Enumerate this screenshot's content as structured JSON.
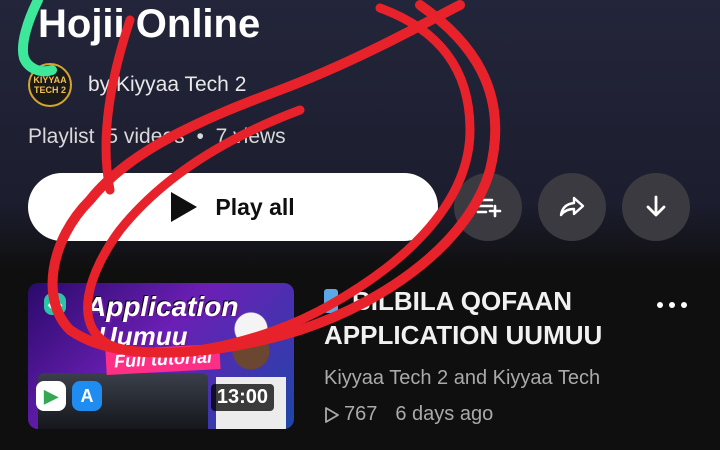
{
  "playlist": {
    "title": "Hojii Online",
    "byline": "by Kiyyaa Tech 2",
    "avatar_text": "KIYYAA TECH 2",
    "meta_type": "Playlist",
    "meta_videos": "5 videos",
    "meta_separator": "•",
    "meta_views": "7 views"
  },
  "actions": {
    "play_all_label": "Play all",
    "save_icon": "playlist-save-icon",
    "share_icon": "share-icon",
    "download_icon": "download-icon"
  },
  "video": {
    "thumbnail": {
      "title": "Application",
      "subtitle": "Uumuu",
      "tag": "Full tutorial"
    },
    "duration": "13:00",
    "title": "BILBILA QOFAAN APPLICATION UUMUU",
    "channel": "Kiyyaa Tech 2 and Kiyyaa Tech",
    "views": "767",
    "age": "6 days ago",
    "menu_icon": "more-vertical-icon"
  },
  "colors": {
    "annotation_red": "#e8222a",
    "annotation_green": "#3ee89a",
    "button_bg": "#3a3a40",
    "accent_pink": "#ff2f86"
  }
}
